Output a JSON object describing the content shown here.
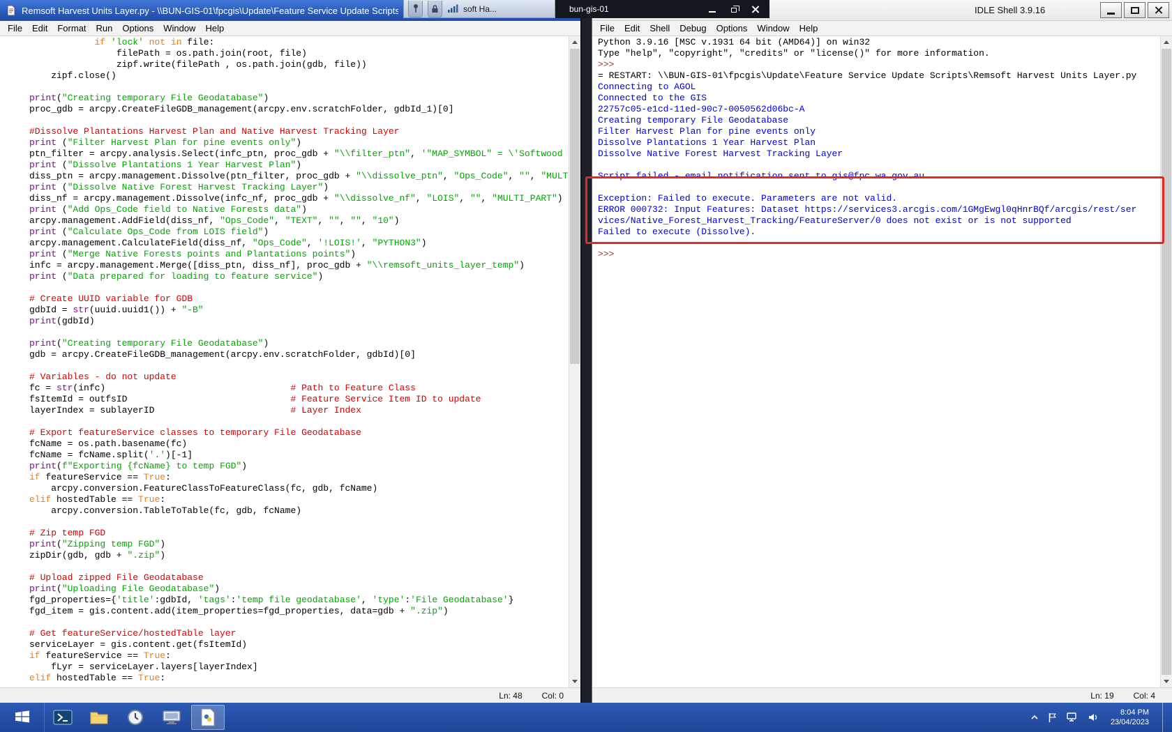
{
  "rdp_bar": {
    "machine_name": "bun-gis-01",
    "title_fragment": "soft Ha...",
    "icons": [
      "pin-icon",
      "lock-icon",
      "signal-strength-icon"
    ],
    "controls": [
      "minimize",
      "restore",
      "close"
    ]
  },
  "editor_window": {
    "title": "Remsoft Harvest Units Layer.py - \\\\BUN-GIS-01\\fpcgis\\Update\\Feature Service Update Scripts",
    "menu": [
      "File",
      "Edit",
      "Format",
      "Run",
      "Options",
      "Window",
      "Help"
    ],
    "status": {
      "line": "Ln: 48",
      "column": "Col: 0"
    },
    "lines": [
      [
        [
          "n",
          "            "
        ],
        [
          "k",
          "if"
        ],
        [
          "n",
          " "
        ],
        [
          "s",
          "'lock'"
        ],
        [
          "n",
          " "
        ],
        [
          "k",
          "not"
        ],
        [
          "n",
          " "
        ],
        [
          "k",
          "in"
        ],
        [
          "n",
          " file:"
        ]
      ],
      [
        [
          "n",
          "                filePath = os.path.join(root, file)"
        ]
      ],
      [
        [
          "n",
          "                zipf.write(filePath , os.path.join(gdb, file))"
        ]
      ],
      [
        [
          "n",
          "    zipf.close()"
        ]
      ],
      [],
      [
        [
          "b",
          "print"
        ],
        [
          "n",
          "("
        ],
        [
          "s",
          "\"Creating temporary File Geodatabase\""
        ],
        [
          "n",
          ")"
        ]
      ],
      [
        [
          "n",
          "proc_gdb = arcpy.CreateFileGDB_management(arcpy.env.scratchFolder, gdbId_1)[0]"
        ]
      ],
      [],
      [
        [
          "c",
          "#Dissolve Plantations Harvest Plan and Native Harvest Tracking Layer"
        ]
      ],
      [
        [
          "b",
          "print"
        ],
        [
          "n",
          " ("
        ],
        [
          "s",
          "\"Filter Harvest Plan for pine events only\""
        ],
        [
          "n",
          ")"
        ]
      ],
      [
        [
          "n",
          "ptn_filter = arcpy.analysis.Select(infc_ptn, proc_gdb + "
        ],
        [
          "s",
          "\"\\\\filter_ptn\""
        ],
        [
          "n",
          ", "
        ],
        [
          "s",
          "'\"MAP_SYMBOL\" = \\'Softwood Plantation\\''"
        ],
        [
          "n",
          ")"
        ]
      ],
      [
        [
          "b",
          "print"
        ],
        [
          "n",
          " ("
        ],
        [
          "s",
          "\"Dissolve Plantations 1 Year Harvest Plan\""
        ],
        [
          "n",
          ")"
        ]
      ],
      [
        [
          "n",
          "diss_ptn = arcpy.management.Dissolve(ptn_filter, proc_gdb + "
        ],
        [
          "s",
          "\"\\\\dissolve_ptn\""
        ],
        [
          "n",
          ", "
        ],
        [
          "s",
          "\"Ops_Code\""
        ],
        [
          "n",
          ", "
        ],
        [
          "s",
          "\"\""
        ],
        [
          "n",
          ", "
        ],
        [
          "s",
          "\"MULTI_PART\""
        ],
        [
          "n",
          ")"
        ]
      ],
      [
        [
          "b",
          "print"
        ],
        [
          "n",
          " ("
        ],
        [
          "s",
          "\"Dissolve Native Forest Harvest Tracking Layer\""
        ],
        [
          "n",
          ")"
        ]
      ],
      [
        [
          "n",
          "diss_nf = arcpy.management.Dissolve(infc_nf, proc_gdb + "
        ],
        [
          "s",
          "\"\\\\dissolve_nf\""
        ],
        [
          "n",
          ", "
        ],
        [
          "s",
          "\"LOIS\""
        ],
        [
          "n",
          ", "
        ],
        [
          "s",
          "\"\""
        ],
        [
          "n",
          ", "
        ],
        [
          "s",
          "\"MULTI_PART\""
        ],
        [
          "n",
          ")"
        ]
      ],
      [
        [
          "b",
          "print"
        ],
        [
          "n",
          " ("
        ],
        [
          "s",
          "\"Add Ops_Code field to Native Forests data\""
        ],
        [
          "n",
          ")"
        ]
      ],
      [
        [
          "n",
          "arcpy.management.AddField(diss_nf, "
        ],
        [
          "s",
          "\"Ops_Code\""
        ],
        [
          "n",
          ", "
        ],
        [
          "s",
          "\"TEXT\""
        ],
        [
          "n",
          ", "
        ],
        [
          "s",
          "\"\""
        ],
        [
          "n",
          ", "
        ],
        [
          "s",
          "\"\""
        ],
        [
          "n",
          ", "
        ],
        [
          "s",
          "\"10\""
        ],
        [
          "n",
          ")"
        ]
      ],
      [
        [
          "b",
          "print"
        ],
        [
          "n",
          " ("
        ],
        [
          "s",
          "\"Calculate Ops_Code from LOIS field\""
        ],
        [
          "n",
          ")"
        ]
      ],
      [
        [
          "n",
          "arcpy.management.CalculateField(diss_nf, "
        ],
        [
          "s",
          "\"Ops_Code\""
        ],
        [
          "n",
          ", "
        ],
        [
          "s",
          "'!LOIS!'"
        ],
        [
          "n",
          ", "
        ],
        [
          "s",
          "\"PYTHON3\""
        ],
        [
          "n",
          ")"
        ]
      ],
      [
        [
          "b",
          "print"
        ],
        [
          "n",
          " ("
        ],
        [
          "s",
          "\"Merge Native Forests points and Plantations points\""
        ],
        [
          "n",
          ")"
        ]
      ],
      [
        [
          "n",
          "infc = arcpy.management.Merge([diss_ptn, diss_nf], proc_gdb + "
        ],
        [
          "s",
          "\"\\\\remsoft_units_layer_temp\""
        ],
        [
          "n",
          ")"
        ]
      ],
      [
        [
          "b",
          "print"
        ],
        [
          "n",
          " ("
        ],
        [
          "s",
          "\"Data prepared for loading to feature service\""
        ],
        [
          "n",
          ")"
        ]
      ],
      [],
      [
        [
          "c",
          "# Create UUID variable for GDB"
        ]
      ],
      [
        [
          "n",
          "gdbId = "
        ],
        [
          "b",
          "str"
        ],
        [
          "n",
          "(uuid.uuid1()) + "
        ],
        [
          "s",
          "\"-B\""
        ]
      ],
      [
        [
          "b",
          "print"
        ],
        [
          "n",
          "(gdbId)"
        ]
      ],
      [],
      [
        [
          "b",
          "print"
        ],
        [
          "n",
          "("
        ],
        [
          "s",
          "\"Creating temporary File Geodatabase\""
        ],
        [
          "n",
          ")"
        ]
      ],
      [
        [
          "n",
          "gdb = arcpy.CreateFileGDB_management(arcpy.env.scratchFolder, gdbId)[0]"
        ]
      ],
      [],
      [
        [
          "c",
          "# Variables - do not update"
        ]
      ],
      [
        [
          "n",
          "fc = "
        ],
        [
          "b",
          "str"
        ],
        [
          "n",
          "(infc)                                  "
        ],
        [
          "c",
          "# Path to Feature Class"
        ]
      ],
      [
        [
          "n",
          "fsItemId = outfsID                              "
        ],
        [
          "c",
          "# Feature Service Item ID to update"
        ]
      ],
      [
        [
          "n",
          "layerIndex = sublayerID                         "
        ],
        [
          "c",
          "# Layer Index"
        ]
      ],
      [],
      [
        [
          "c",
          "# Export featureService classes to temporary File Geodatabase"
        ]
      ],
      [
        [
          "n",
          "fcName = os.path.basename(fc)"
        ]
      ],
      [
        [
          "n",
          "fcName = fcName.split("
        ],
        [
          "s",
          "'.'"
        ],
        [
          "n",
          ")[-1]"
        ]
      ],
      [
        [
          "b",
          "print"
        ],
        [
          "n",
          "("
        ],
        [
          "s",
          "f\"Exporting {fcName} to temp FGD\""
        ],
        [
          "n",
          ")"
        ]
      ],
      [
        [
          "k",
          "if"
        ],
        [
          "n",
          " featureService == "
        ],
        [
          "k",
          "True"
        ],
        [
          "n",
          ":"
        ]
      ],
      [
        [
          "n",
          "    arcpy.conversion.FeatureClassToFeatureClass(fc, gdb, fcName)"
        ]
      ],
      [
        [
          "k",
          "elif"
        ],
        [
          "n",
          " hostedTable == "
        ],
        [
          "k",
          "True"
        ],
        [
          "n",
          ":"
        ]
      ],
      [
        [
          "n",
          "    arcpy.conversion.TableToTable(fc, gdb, fcName)"
        ]
      ],
      [],
      [
        [
          "c",
          "# Zip temp FGD"
        ]
      ],
      [
        [
          "b",
          "print"
        ],
        [
          "n",
          "("
        ],
        [
          "s",
          "\"Zipping temp FGD\""
        ],
        [
          "n",
          ")"
        ]
      ],
      [
        [
          "n",
          "zipDir(gdb, gdb + "
        ],
        [
          "s",
          "\".zip\""
        ],
        [
          "n",
          ")"
        ]
      ],
      [],
      [
        [
          "c",
          "# Upload zipped File Geodatabase"
        ]
      ],
      [
        [
          "b",
          "print"
        ],
        [
          "n",
          "("
        ],
        [
          "s",
          "\"Uploading File Geodatabase\""
        ],
        [
          "n",
          ")"
        ]
      ],
      [
        [
          "n",
          "fgd_properties={"
        ],
        [
          "s",
          "'title'"
        ],
        [
          "n",
          ":gdbId, "
        ],
        [
          "s",
          "'tags'"
        ],
        [
          "n",
          ":"
        ],
        [
          "s",
          "'temp file geodatabase'"
        ],
        [
          "n",
          ", "
        ],
        [
          "s",
          "'type'"
        ],
        [
          "n",
          ":"
        ],
        [
          "s",
          "'File Geodatabase'"
        ],
        [
          "n",
          "}"
        ]
      ],
      [
        [
          "n",
          "fgd_item = gis.content.add(item_properties=fgd_properties, data=gdb + "
        ],
        [
          "s",
          "\".zip\""
        ],
        [
          "n",
          ")"
        ]
      ],
      [],
      [
        [
          "c",
          "# Get featureService/hostedTable layer"
        ]
      ],
      [
        [
          "n",
          "serviceLayer = gis.content.get(fsItemId)"
        ]
      ],
      [
        [
          "k",
          "if"
        ],
        [
          "n",
          " featureService == "
        ],
        [
          "k",
          "True"
        ],
        [
          "n",
          ":"
        ]
      ],
      [
        [
          "n",
          "    fLyr = serviceLayer.layers[layerIndex]"
        ]
      ],
      [
        [
          "k",
          "elif"
        ],
        [
          "n",
          " hostedTable == "
        ],
        [
          "k",
          "True"
        ],
        [
          "n",
          ":"
        ]
      ]
    ]
  },
  "shell_window": {
    "title": "IDLE Shell 3.9.16",
    "menu": [
      "File",
      "Edit",
      "Shell",
      "Debug",
      "Options",
      "Window",
      "Help"
    ],
    "window_controls": [
      "minimize",
      "maximize",
      "close"
    ],
    "status": {
      "line": "Ln: 19",
      "column": "Col: 4"
    },
    "lines": [
      [
        [
          "txt",
          "Python 3.9.16 [MSC v.1931 64 bit (AMD64)] on win32"
        ]
      ],
      [
        [
          "txt",
          "Type \"help\", \"copyright\", \"credits\" or \"license()\" for more information."
        ]
      ],
      [
        [
          "p",
          ">>>"
        ]
      ],
      [
        [
          "txt",
          "= RESTART: \\\\BUN-GIS-01\\fpcgis\\Update\\Feature Service Update Scripts\\Remsoft Harvest Units Layer.py"
        ]
      ],
      [
        [
          "out",
          "Connecting to AGOL"
        ]
      ],
      [
        [
          "out",
          "Connected to the GIS"
        ]
      ],
      [
        [
          "out",
          "22757c05-e1cd-11ed-90c7-0050562d06bc-A"
        ]
      ],
      [
        [
          "out",
          "Creating temporary File Geodatabase"
        ]
      ],
      [
        [
          "out",
          "Filter Harvest Plan for pine events only"
        ]
      ],
      [
        [
          "out",
          "Dissolve Plantations 1 Year Harvest Plan"
        ]
      ],
      [
        [
          "out",
          "Dissolve Native Forest Harvest Tracking Layer"
        ]
      ],
      [],
      [
        [
          "out",
          "Script failed - email notification sent to gis@fpc.wa.gov.au"
        ]
      ],
      [],
      [
        [
          "out",
          "Exception: Failed to execute. Parameters are not valid."
        ]
      ],
      [
        [
          "out",
          "ERROR 000732: Input Features: Dataset https://services3.arcgis.com/1GMgEwgl0qHnrBQf/arcgis/rest/ser"
        ]
      ],
      [
        [
          "out",
          "vices/Native_Forest_Harvest_Tracking/FeatureServer/0 does not exist or is not supported"
        ]
      ],
      [
        [
          "out",
          "Failed to execute (Dissolve)."
        ]
      ],
      [],
      [
        [
          "p",
          ">>>"
        ]
      ]
    ]
  },
  "taskbar": {
    "icons": [
      "start-button",
      "powershell",
      "file-explorer",
      "clock-app",
      "remote-desktop",
      "python-idle"
    ],
    "tray_icons": [
      "hidden-icons-chevron",
      "flag-icon",
      "network-icon",
      "volume-icon"
    ],
    "time": "8:04 PM",
    "date": "23/04/2023"
  },
  "colors": {
    "keyword": "#ff7700",
    "builtin": "#900090",
    "string": "#00aa00",
    "comment": "#dd0000",
    "stdout": "#0000e6",
    "prompt": "#a8342c",
    "annotation_red": "#e12a24",
    "titlebar_blue": "#2a5cba",
    "taskbar_blue": "#2450a4"
  }
}
